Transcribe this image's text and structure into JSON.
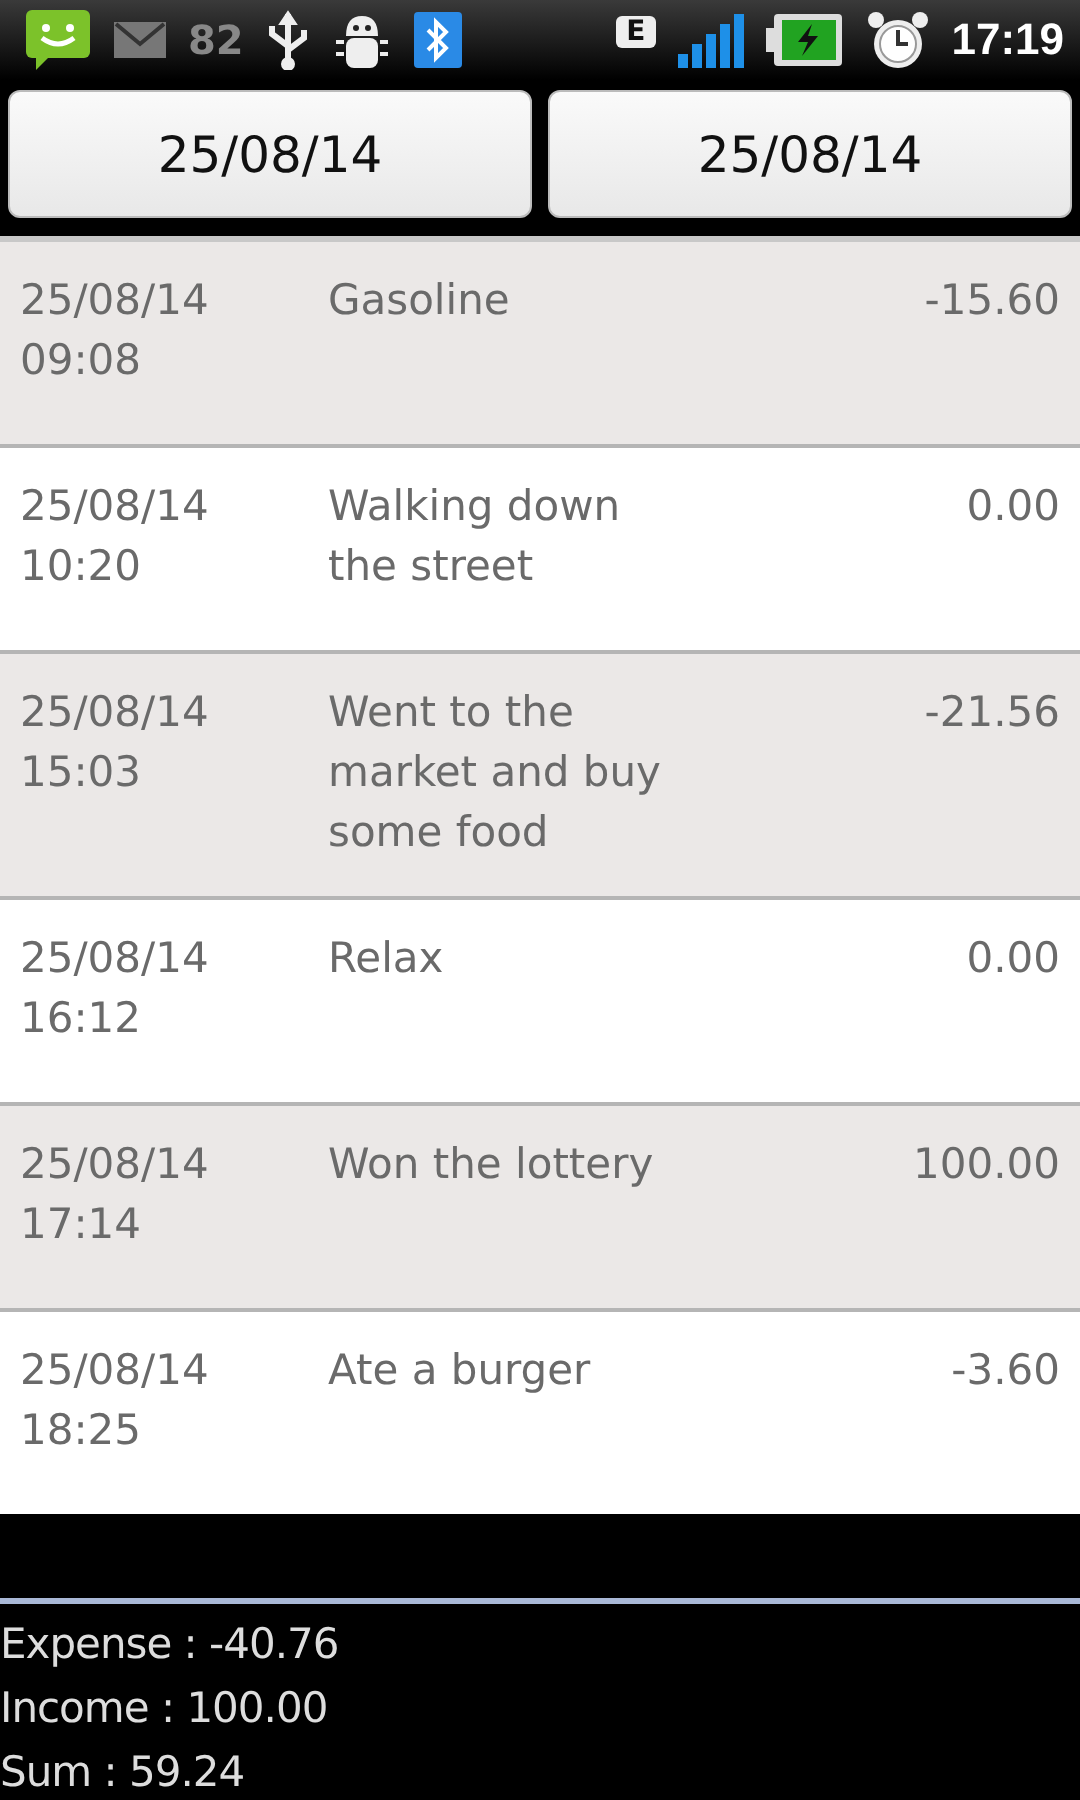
{
  "status_bar": {
    "notification_count": "82",
    "network_type": "E",
    "time": "17:19"
  },
  "date_range": {
    "from": "25/08/14",
    "to": "25/08/14"
  },
  "entries": [
    {
      "date": "25/08/14",
      "time": "09:08",
      "description": "Gasoline",
      "amount": "-15.60"
    },
    {
      "date": "25/08/14",
      "time": "10:20",
      "description": "Walking down the street",
      "amount": "0.00"
    },
    {
      "date": "25/08/14",
      "time": "15:03",
      "description": "Went to the market and buy some food",
      "amount": "-21.56"
    },
    {
      "date": "25/08/14",
      "time": "16:12",
      "description": "Relax",
      "amount": "0.00"
    },
    {
      "date": "25/08/14",
      "time": "17:14",
      "description": "Won the lottery",
      "amount": "100.00"
    },
    {
      "date": "25/08/14",
      "time": "18:25",
      "description": "Ate a burger",
      "amount": "-3.60"
    }
  ],
  "totals": [
    "Expense : -40.76",
    "Income : 100.00",
    "Sum : 59.24"
  ]
}
